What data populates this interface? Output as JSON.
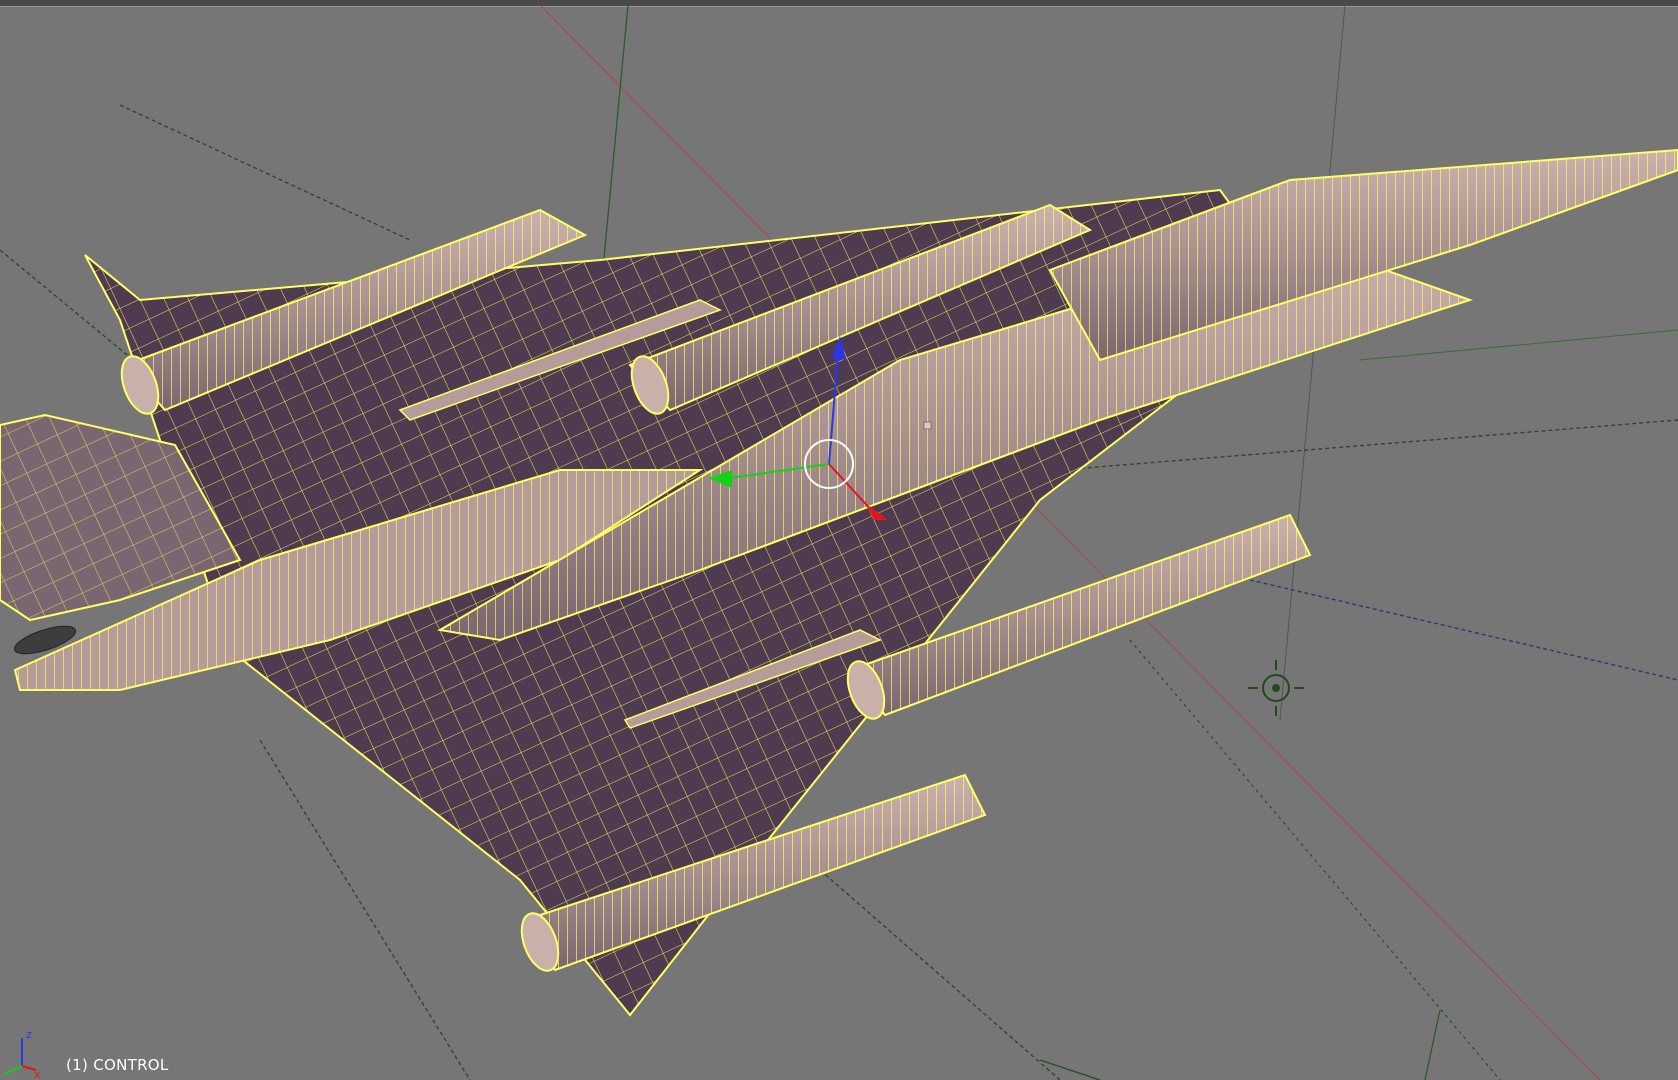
{
  "viewport": {
    "object_label": "(1) CONTROL",
    "background_color": "#767676",
    "wire_color": "#ffff66",
    "surface_color": "#4e3b50",
    "tube_color": "#b59c9a"
  },
  "axis_icon": {
    "x_label": "x",
    "z_label": "z"
  },
  "manipulator": {
    "x_color": "#e8141a",
    "y_color": "#14d214",
    "z_color": "#2a36e8"
  }
}
